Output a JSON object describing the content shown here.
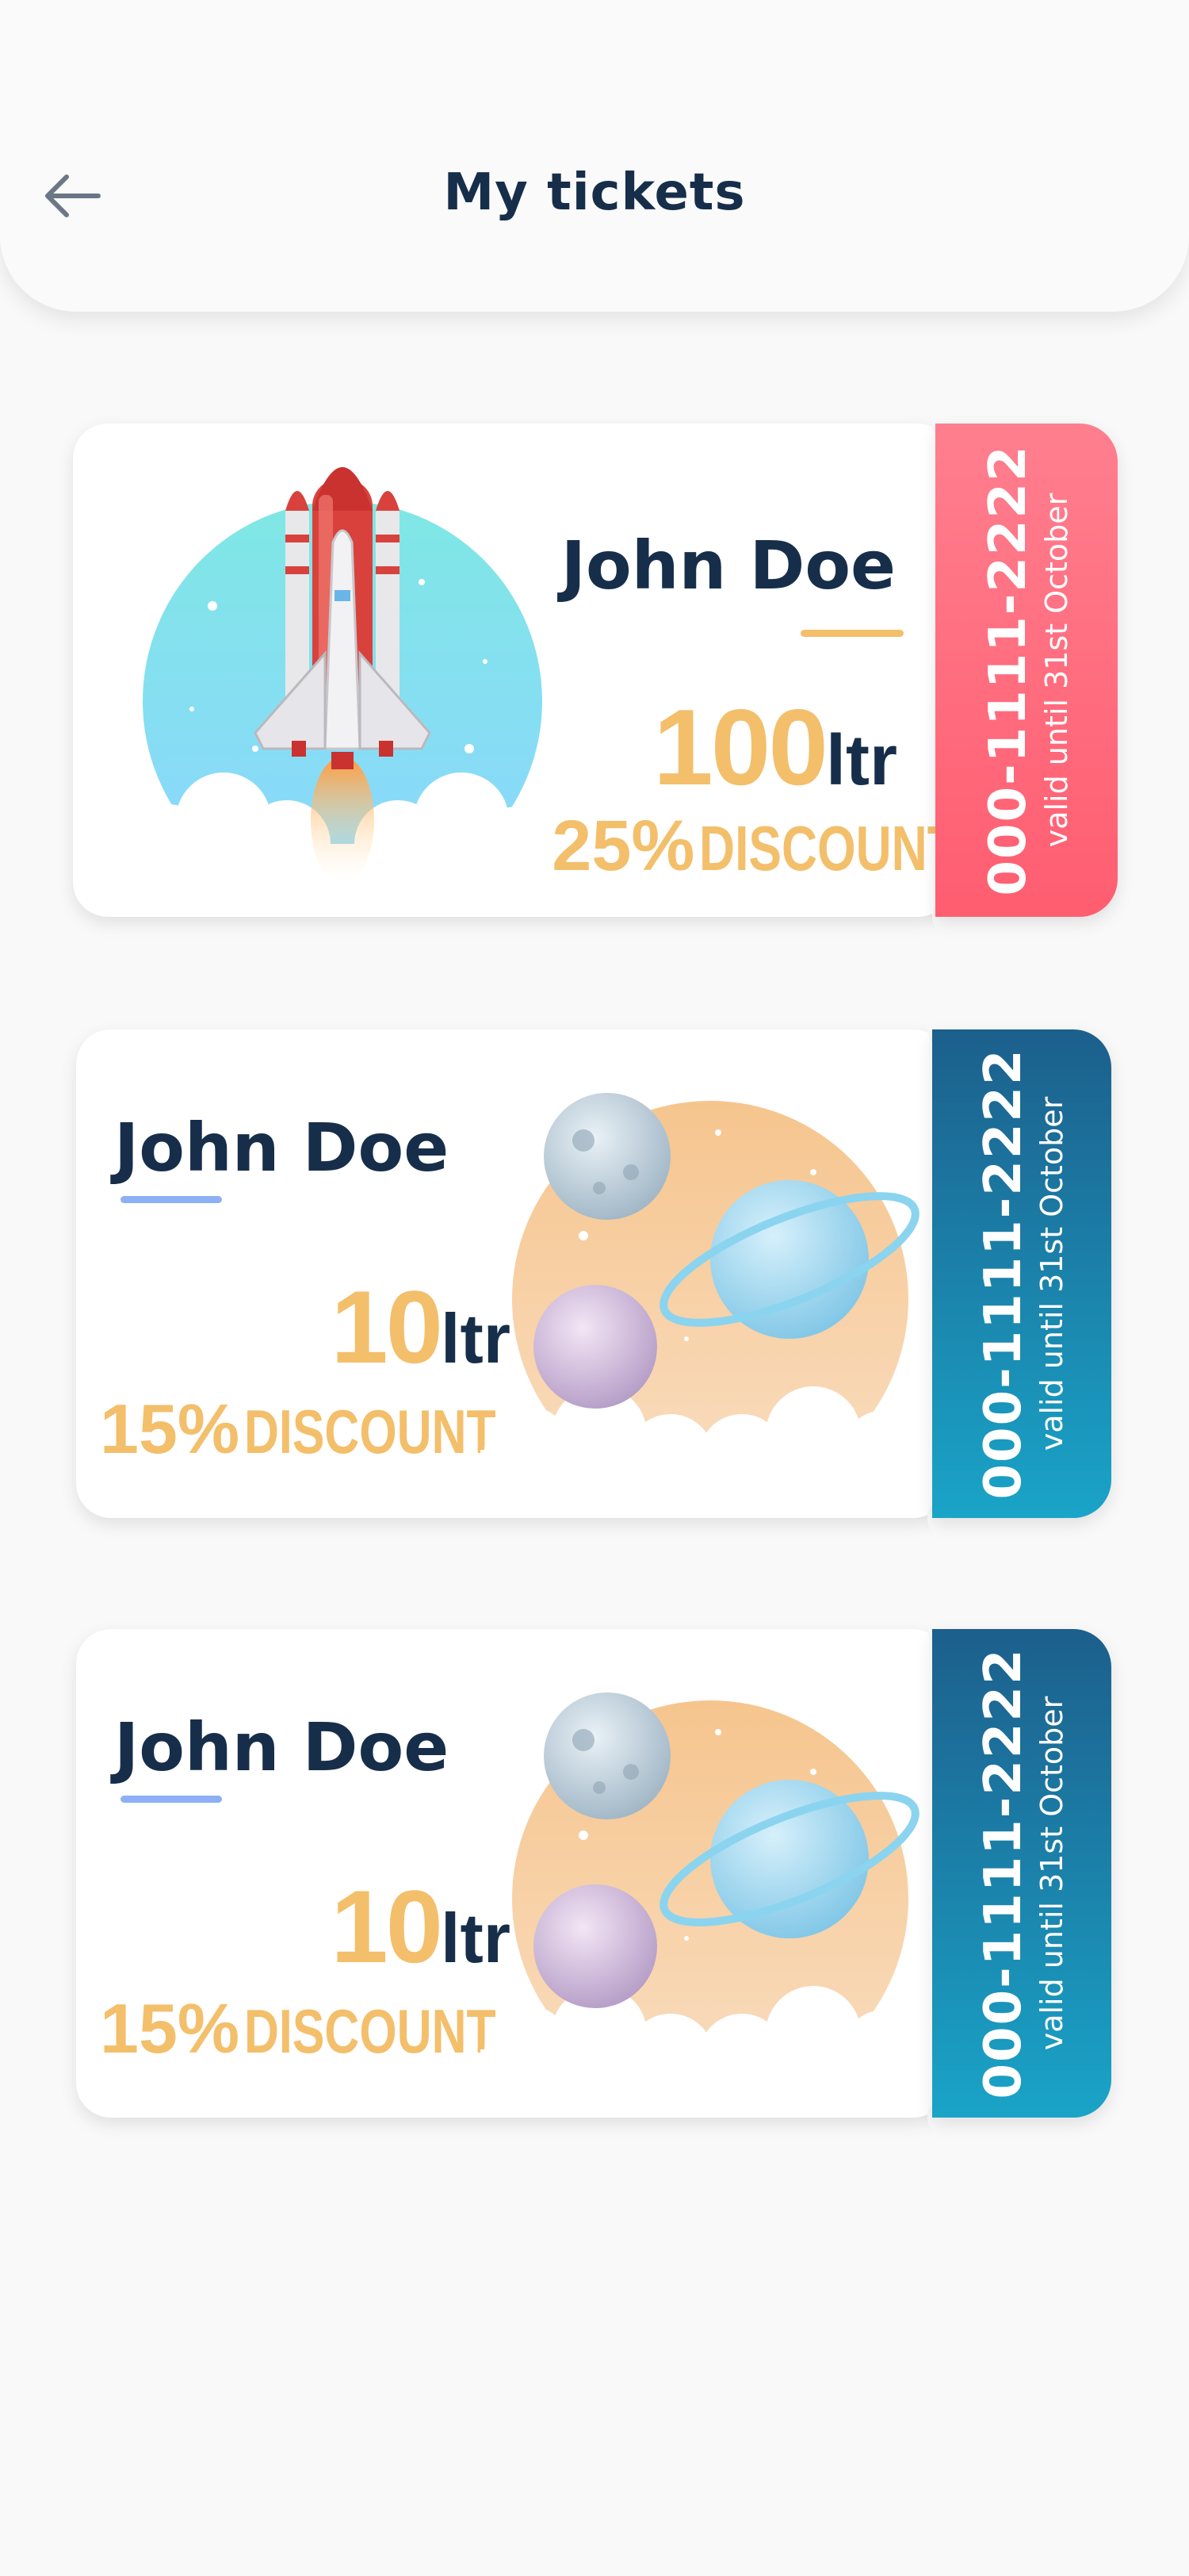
{
  "header": {
    "title": "My tickets"
  },
  "tickets": [
    {
      "name": "John Doe",
      "amount": "100",
      "unit": "ltr",
      "discount_pct": "25%",
      "discount_word": "DISCOUNT",
      "code": "000-1111-2222",
      "valid": "valid until 31st October",
      "stub_colors": [
        "#ff5d70",
        "#ff7f8f"
      ],
      "underline_color": "#f3bf6b",
      "illustration": "rocket-illustration"
    },
    {
      "name": "John Doe",
      "amount": "10",
      "unit": "ltr",
      "discount_pct": "15%",
      "discount_word": "DISCOUNT",
      "code": "000-1111-2222",
      "valid": "valid until 31st October",
      "stub_colors": [
        "#1c5f8c",
        "#1aa4c8"
      ],
      "underline_color": "#8db0f5",
      "illustration": "planets-illustration"
    },
    {
      "name": "John Doe",
      "amount": "10",
      "unit": "ltr",
      "discount_pct": "15%",
      "discount_word": "DISCOUNT",
      "code": "000-1111-2222",
      "valid": "valid until 31st October",
      "stub_colors": [
        "#1c5f8c",
        "#1aa4c8"
      ],
      "underline_color": "#8db0f5",
      "illustration": "planets-illustration"
    }
  ]
}
